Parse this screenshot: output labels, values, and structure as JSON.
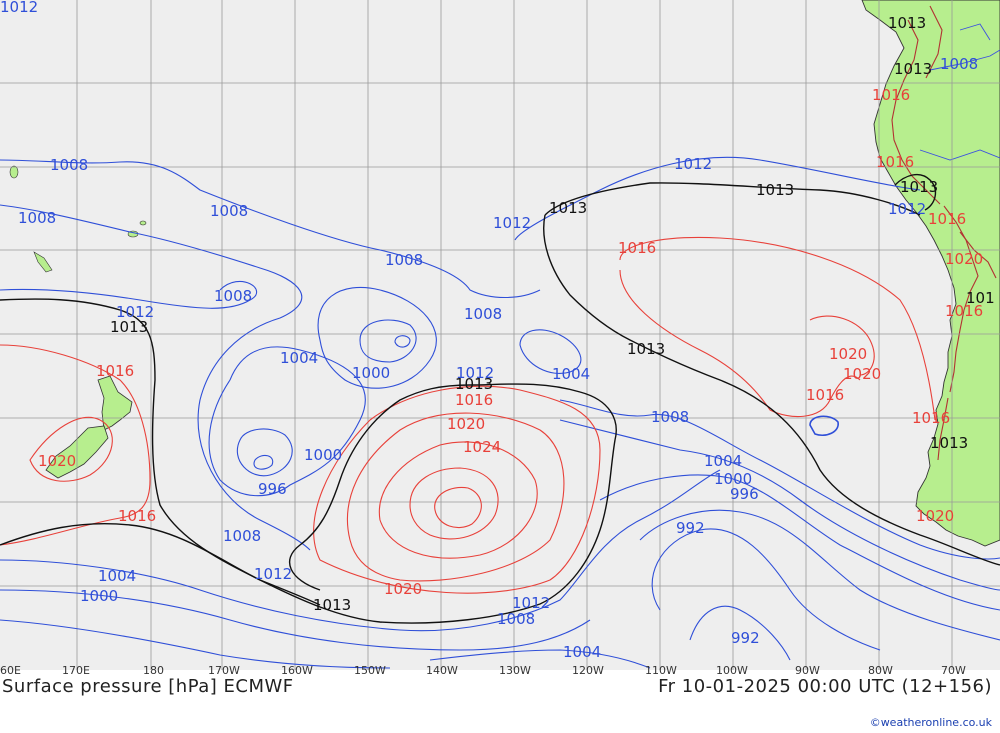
{
  "footer": {
    "title": "Surface pressure [hPa] ECMWF",
    "datetime": "Fr 10-01-2025 00:00 UTC (12+156)",
    "credit": "©weatheronline.co.uk"
  },
  "colors": {
    "ocean": "#eeeeee",
    "land": "#b7ee8e",
    "grid": "#999999",
    "low_isobar": "#2f4fd8",
    "high_isobar": "#e8413a",
    "standard_isobar": "#111111",
    "mountains": "#b23232"
  },
  "longitude_ticks": [
    "60E",
    "170E",
    "180",
    "170W",
    "160W",
    "150W",
    "140W",
    "130W",
    "120W",
    "110W",
    "100W",
    "90W",
    "80W",
    "70W"
  ],
  "isobar_labels": [
    {
      "text": "1012",
      "color": "low"
    },
    {
      "text": "1008",
      "color": "low"
    },
    {
      "text": "1008",
      "color": "low"
    },
    {
      "text": "1008",
      "color": "low"
    },
    {
      "text": "1008",
      "color": "low"
    },
    {
      "text": "1008",
      "color": "low"
    },
    {
      "text": "1012",
      "color": "low"
    },
    {
      "text": "1013",
      "color": "std"
    },
    {
      "text": "1004",
      "color": "low"
    },
    {
      "text": "1000",
      "color": "low"
    },
    {
      "text": "1000",
      "color": "low"
    },
    {
      "text": "996",
      "color": "low"
    },
    {
      "text": "1008",
      "color": "low"
    },
    {
      "text": "1012",
      "color": "low"
    },
    {
      "text": "1013",
      "color": "std"
    },
    {
      "text": "1004",
      "color": "low"
    },
    {
      "text": "1000",
      "color": "low"
    },
    {
      "text": "1016",
      "color": "high"
    },
    {
      "text": "1020",
      "color": "high"
    },
    {
      "text": "1016",
      "color": "high"
    },
    {
      "text": "1012",
      "color": "low"
    },
    {
      "text": "1013",
      "color": "std"
    },
    {
      "text": "1012",
      "color": "low"
    },
    {
      "text": "1013",
      "color": "std"
    },
    {
      "text": "1016",
      "color": "high"
    },
    {
      "text": "1020",
      "color": "high"
    },
    {
      "text": "1024",
      "color": "high"
    },
    {
      "text": "1020",
      "color": "high"
    },
    {
      "text": "1012",
      "color": "low"
    },
    {
      "text": "1008",
      "color": "low"
    },
    {
      "text": "1004",
      "color": "low"
    },
    {
      "text": "1004",
      "color": "low"
    },
    {
      "text": "1008",
      "color": "low"
    },
    {
      "text": "1012",
      "color": "low"
    },
    {
      "text": "1013",
      "color": "std"
    },
    {
      "text": "1013",
      "color": "std"
    },
    {
      "text": "1016",
      "color": "high"
    },
    {
      "text": "1008",
      "color": "low"
    },
    {
      "text": "1004",
      "color": "low"
    },
    {
      "text": "1000",
      "color": "low"
    },
    {
      "text": "996",
      "color": "low"
    },
    {
      "text": "992",
      "color": "low"
    },
    {
      "text": "992",
      "color": "low"
    },
    {
      "text": "1020",
      "color": "high"
    },
    {
      "text": "1020",
      "color": "high"
    },
    {
      "text": "1016",
      "color": "high"
    },
    {
      "text": "1016",
      "color": "high"
    },
    {
      "text": "1013",
      "color": "std"
    },
    {
      "text": "1013",
      "color": "std"
    },
    {
      "text": "1013",
      "color": "std"
    },
    {
      "text": "1013",
      "color": "std"
    },
    {
      "text": "1016",
      "color": "high"
    },
    {
      "text": "1016",
      "color": "high"
    },
    {
      "text": "1020",
      "color": "high"
    },
    {
      "text": "1016",
      "color": "high"
    },
    {
      "text": "1016",
      "color": "high"
    },
    {
      "text": "1020",
      "color": "high"
    },
    {
      "text": "1013",
      "color": "std"
    },
    {
      "text": "1008",
      "color": "low"
    },
    {
      "text": "1012",
      "color": "low"
    },
    {
      "text": "101",
      "color": "std"
    }
  ]
}
